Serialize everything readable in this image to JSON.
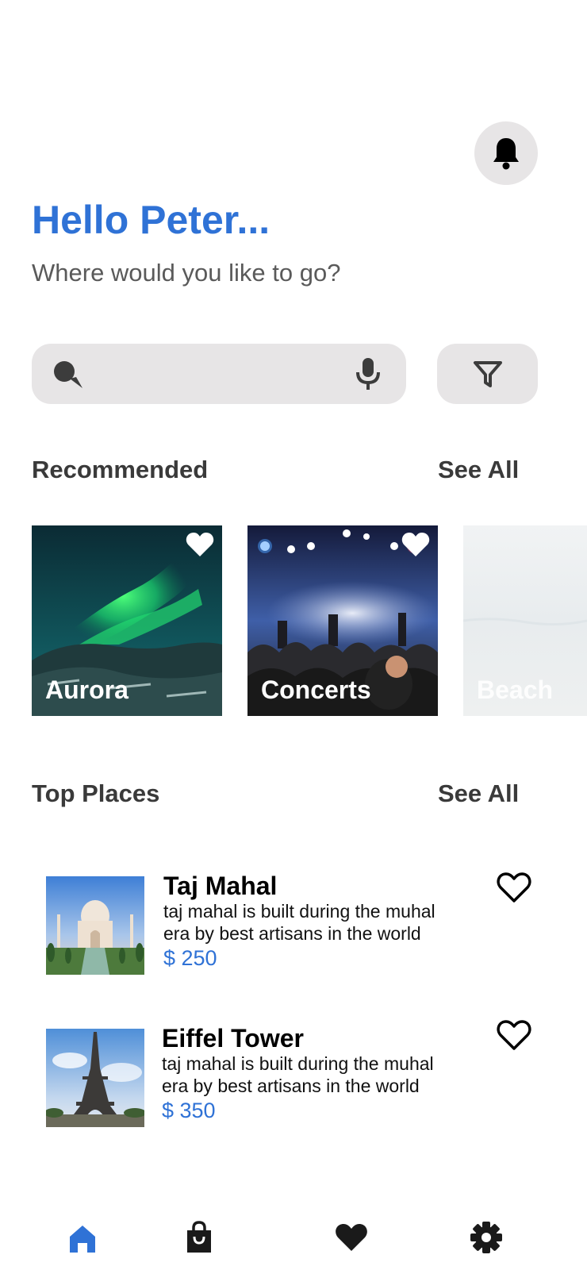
{
  "header": {
    "greeting": "Hello Peter...",
    "subtitle": "Where would you like to go?",
    "bell_icon": "bell-icon"
  },
  "search": {
    "placeholder": "",
    "search_icon": "search-icon",
    "mic_icon": "microphone-icon",
    "filter_icon": "filter-icon"
  },
  "recommended": {
    "title": "Recommended",
    "see_all": "See All",
    "items": [
      {
        "label": "Aurora"
      },
      {
        "label": "Concerts"
      },
      {
        "label": "Beach"
      }
    ]
  },
  "top_places": {
    "title": "Top Places",
    "see_all": "See All",
    "items": [
      {
        "name": "Taj Mahal",
        "description": "taj mahal is built during the muhal era by best artisans in the world",
        "price": "$ 250"
      },
      {
        "name": "Eiffel Tower",
        "description": "taj mahal is built during the muhal era by best artisans in the world",
        "price": "$ 350"
      }
    ]
  },
  "bottom_nav": {
    "items": [
      "home-icon",
      "shopping-bag-icon",
      "heart-icon",
      "settings-icon"
    ],
    "active_color": "#2f72d6",
    "inactive_color": "#1a1a1a"
  },
  "colors": {
    "accent": "#2f72d6",
    "surface": "#e7e5e6"
  }
}
